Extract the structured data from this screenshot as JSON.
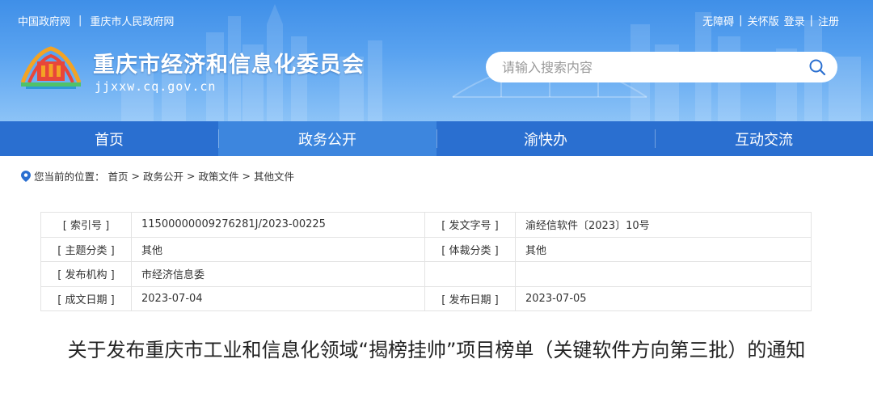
{
  "topbar": {
    "left_links": [
      "中国政府网",
      "重庆市人民政府网"
    ],
    "divider": "|",
    "right_links": [
      "无障碍",
      "关怀版",
      "登录",
      "注册"
    ]
  },
  "site": {
    "title": "重庆市经济和信息化委员会",
    "domain": "jjxxw.cq.gov.cn"
  },
  "search": {
    "placeholder": "请输入搜索内容"
  },
  "nav": {
    "items": [
      "首页",
      "政务公开",
      "渝快办",
      "互动交流"
    ],
    "active_index": 1
  },
  "breadcrumb": {
    "prefix": "您当前的位置：",
    "items": [
      "首页",
      "政务公开",
      "政策文件",
      "其他文件"
    ],
    "separator": ">"
  },
  "meta": {
    "rows": [
      {
        "k1": "[ 索引号 ]",
        "v1": "11500000009276281J/2023-00225",
        "k2": "[ 发文字号 ]",
        "v2": "渝经信软件〔2023〕10号"
      },
      {
        "k1": "[ 主题分类 ]",
        "v1": "其他",
        "k2": "[ 体裁分类 ]",
        "v2": "其他"
      },
      {
        "k1": "[ 发布机构 ]",
        "v1": "市经济信息委",
        "k2": "",
        "v2": ""
      },
      {
        "k1": "[ 成文日期 ]",
        "v1": "2023-07-04",
        "k2": "[ 发布日期 ]",
        "v2": "2023-07-05"
      }
    ]
  },
  "document": {
    "title": "关于发布重庆市工业和信息化领域“揭榜挂帅”项目榜单（关键软件方向第三批）的通知"
  },
  "colors": {
    "header_blue": "#3f8fe8",
    "nav_blue": "#2a6fd0",
    "nav_active": "#3d86de",
    "pin": "#2a6fd0"
  }
}
